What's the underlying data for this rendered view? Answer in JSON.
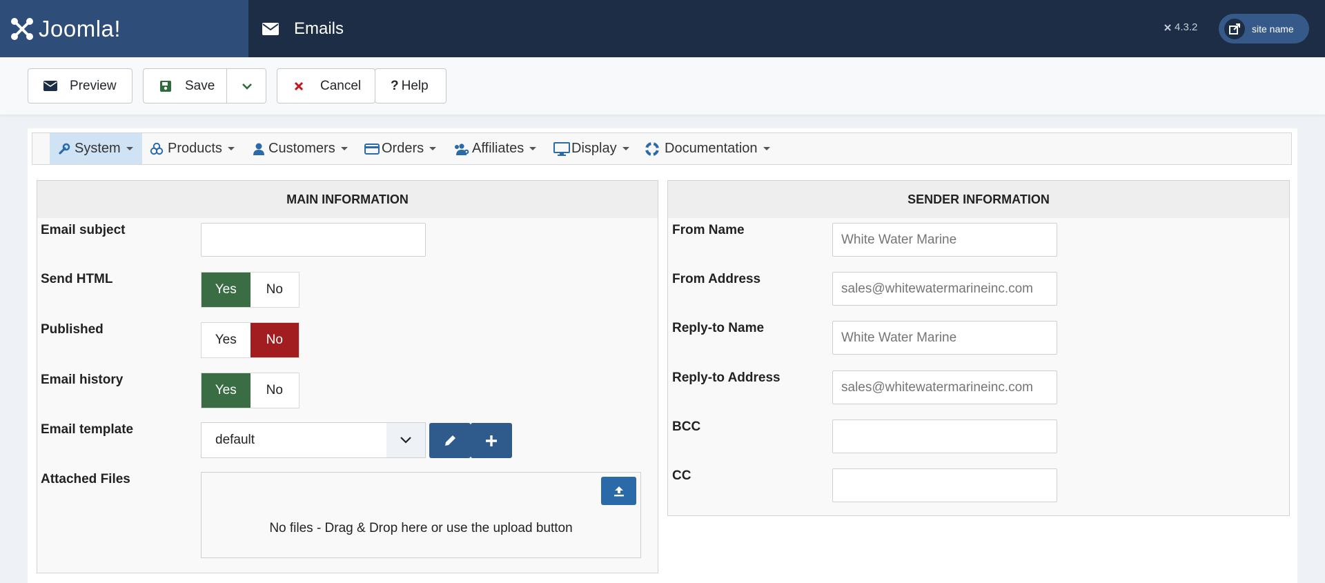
{
  "header": {
    "logo_text": "Joomla!",
    "page_title": "Emails",
    "version": "4.3.2",
    "site_button_label": "site name"
  },
  "toolbar": {
    "preview_label": "Preview",
    "save_label": "Save",
    "cancel_label": "Cancel",
    "help_label": "Help"
  },
  "menu": {
    "items": [
      {
        "label": "System",
        "icon": "wrench-icon",
        "active": true
      },
      {
        "label": "Products",
        "icon": "cubes-icon"
      },
      {
        "label": "Customers",
        "icon": "user-icon"
      },
      {
        "label": "Orders",
        "icon": "credit-card-icon"
      },
      {
        "label": "Affiliates",
        "icon": "users-cog-icon"
      },
      {
        "label": "Display",
        "icon": "desktop-icon"
      },
      {
        "label": "Documentation",
        "icon": "life-ring-icon"
      }
    ]
  },
  "main_info": {
    "heading": "MAIN INFORMATION",
    "email_subject_label": "Email subject",
    "email_subject_value": "",
    "send_html_label": "Send HTML",
    "send_html_value": "Yes",
    "published_label": "Published",
    "published_value": "No",
    "email_history_label": "Email history",
    "email_history_value": "Yes",
    "yes_label": "Yes",
    "no_label": "No",
    "email_template_label": "Email template",
    "email_template_value": "default",
    "attached_files_label": "Attached Files",
    "dropzone_text": "No files - Drag & Drop here or use the upload button"
  },
  "sender_info": {
    "heading": "SENDER INFORMATION",
    "from_name_label": "From Name",
    "from_name_placeholder": "White Water Marine",
    "from_address_label": "From Address",
    "from_address_placeholder": "sales@whitewatermarineinc.com",
    "reply_to_name_label": "Reply-to Name",
    "reply_to_name_placeholder": "White Water Marine",
    "reply_to_address_label": "Reply-to Address",
    "reply_to_address_placeholder": "sales@whitewatermarineinc.com",
    "bcc_label": "BCC",
    "bcc_value": "",
    "cc_label": "CC",
    "cc_value": ""
  },
  "colors": {
    "header_bg": "#1c2d45",
    "logo_bg": "#2e4d78",
    "yes_active": "#3b6d45",
    "no_active": "#a11d20",
    "primary_button": "#2f5a8c"
  }
}
